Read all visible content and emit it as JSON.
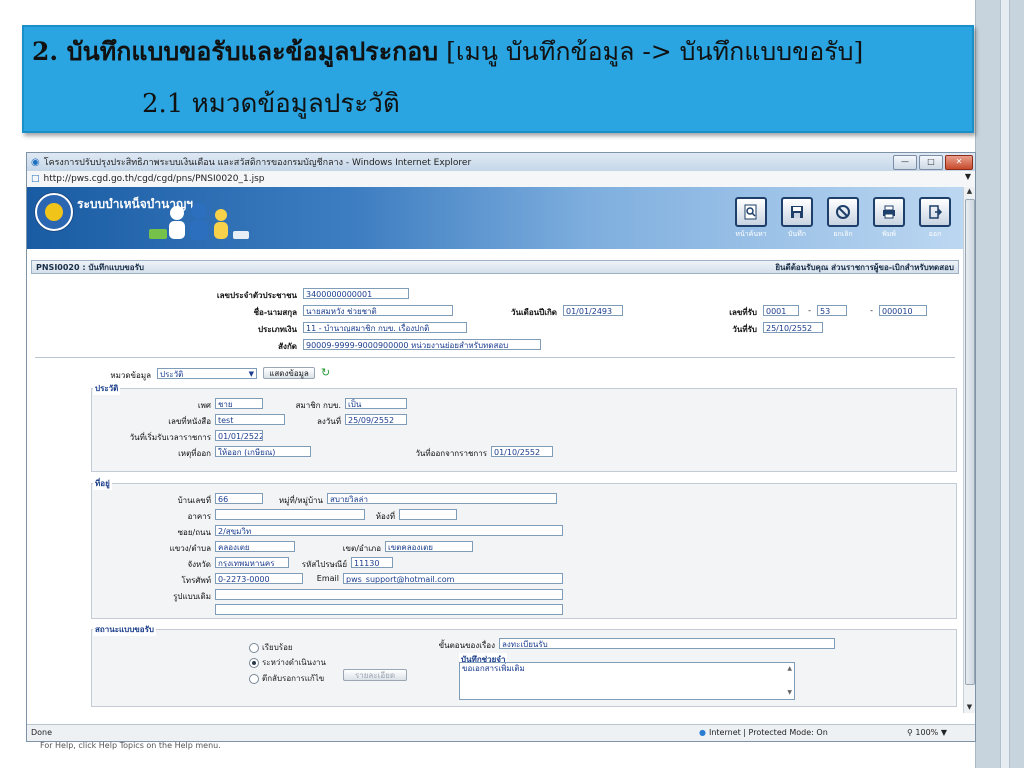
{
  "slide": {
    "title_bold": "2. บันทึกแบบขอรับและข้อมูลประกอบ",
    "title_rest": "[เมนู บันทึกข้อมูล -> บันทึกแบบขอรับ]",
    "subtitle": "2.1 หมวดข้อมูลประวัติ",
    "footer_text": "For Help, click Help Topics on the Help menu."
  },
  "browser": {
    "window_title": "โครงการปรับปรุงประสิทธิภาพระบบเงินเดือน และสวัสดิการของกรมบัญชีกลาง - Windows Internet Explorer",
    "url": "http://pws.cgd.go.th/cgd/cgd/pns/PNSI0020_1.jsp",
    "status_done": "Done",
    "status_zone": "Internet | Protected Mode: On",
    "status_zoom": "100%"
  },
  "app": {
    "name": "ระบบบำเหน็จบำนาญฯ",
    "toolbar": {
      "search_label": "หน้าค้นหา",
      "save_label": "บันทึก",
      "cancel_label": "ยกเลิก",
      "print_label": "พิมพ์",
      "exit_label": "ออก"
    }
  },
  "form": {
    "code_title": "PNSI0020 : บันทึกแบบขอรับ",
    "welcome": "ยินดีต้อนรับคุณ ส่วนราชการผู้ขอ-เบิกสำหรับทดสอบ",
    "id_label": "เลขประจำตัวประชาชน",
    "id_value": "3400000000001",
    "name_label": "ชื่อ-นามสกุล",
    "name_value": "นายสมหวัง ช่วยชาติ",
    "birth_label": "วันเดือนปีเกิด",
    "birth_value": "01/01/2493",
    "type_label": "ประเภทเงิน",
    "type_value": "11 - บำนาญสมาชิก กบข. เรื่องปกติ",
    "affil_label": "สังกัด",
    "affil_value": "90009-9999-9000900000  หน่วยงานย่อยสำหรับทดสอบ",
    "receive_no_label": "เลขที่รับ",
    "receive_no_1": "0001",
    "receive_no_2": "53",
    "receive_no_3": "000010",
    "receive_sep": "-",
    "receive_date_label": "วันที่รับ",
    "receive_date_value": "25/10/2552",
    "category_label": "หมวดข้อมูล",
    "category_value": "ประวัติ",
    "show_button": "แสดงข้อมูล"
  },
  "history": {
    "group_title": "ประวัติ",
    "sex_label": "เพศ",
    "sex_value": "ชาย",
    "gpf_label": "สมาชิก กบข.",
    "gpf_value": "เป็น",
    "doc_no_label": "เลขที่หนังสือ",
    "doc_no_value": "test",
    "doc_date_label": "ลงวันที่",
    "doc_date_value": "25/09/2552",
    "start_label": "วันที่เริ่มรับเวลาราชการ",
    "start_value": "01/01/2522",
    "reason_label": "เหตุที่ออก",
    "reason_value": "ให้ออก (เกษียณ)",
    "leave_label": "วันที่ออกจากราชการ",
    "leave_value": "01/10/2552"
  },
  "address": {
    "group_title": "ที่อยู่",
    "house_label": "บ้านเลขที่",
    "house_value": "66",
    "village_label": "หมู่ที่/หมู่บ้าน",
    "village_value": "สบายวิลล่า",
    "building_label": "อาคาร",
    "building_value": "",
    "room_label": "ห้องที่",
    "room_value": "",
    "soi_label": "ซอย/ถนน",
    "soi_value": "2/สุขุมวิท",
    "subdistrict_label": "แขวง/ตำบล",
    "subdistrict_value": "คลองเตย",
    "district_label": "เขต/อำเภอ",
    "district_value": "เขตคลองเตย",
    "province_label": "จังหวัด",
    "province_value": "กรุงเทพมหานคร",
    "zip_label": "รหัสไปรษณีย์",
    "zip_value": "11130",
    "phone_label": "โทรศัพท์",
    "phone_value": "0-2273-0000",
    "email_label": "Email",
    "email_value": "pws_support@hotmail.com",
    "legacy_label": "รูปแบบเดิม",
    "legacy_value_1": "",
    "legacy_value_2": ""
  },
  "status": {
    "group_title": "สถานะแบบขอรับ",
    "opt_complete": "เรียบร้อย",
    "opt_in_progress": "ระหว่างดำเนินงาน",
    "opt_return": "ตีกลับรอการแก้ไข",
    "detail_button": "รายละเอียด",
    "step_label": "ขั้นตอนของเรื่อง",
    "step_value": "ลงทะเบียนรับ",
    "memo_title": "บันทึกช่วยจำ",
    "memo_value": "ขอเอกสารเพิ่มเติม"
  }
}
